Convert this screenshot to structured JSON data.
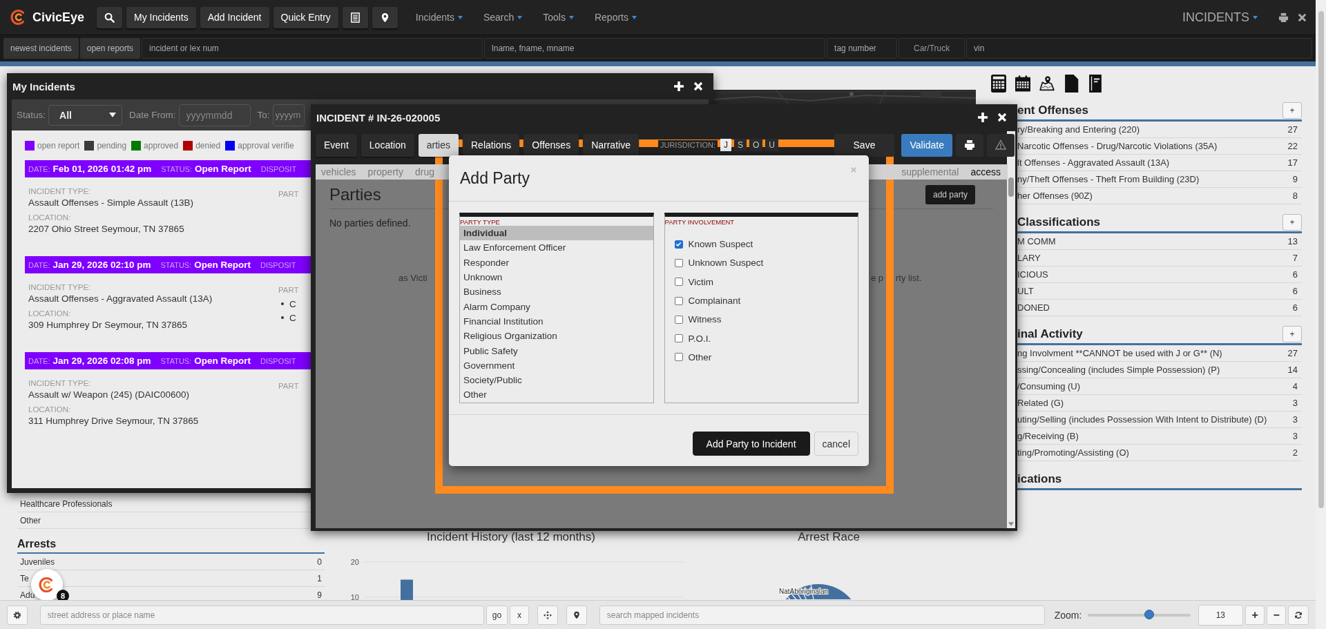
{
  "nav": {
    "brand": "CivicEye",
    "buttons": [
      {
        "kind": "search"
      },
      {
        "kind": "text",
        "label": "My Incidents"
      },
      {
        "kind": "text",
        "label": "Add Incident"
      },
      {
        "kind": "text",
        "label": "Quick Entry"
      },
      {
        "kind": "list"
      },
      {
        "kind": "marker"
      }
    ],
    "menus": [
      "Incidents",
      "Search",
      "Tools",
      "Reports"
    ],
    "module": "INCIDENTS"
  },
  "quick_search": {
    "buttons": [
      "newest incidents",
      "open reports"
    ],
    "fields": [
      {
        "kind": "input",
        "placeholder": "incident or lex num"
      },
      {
        "kind": "input",
        "placeholder": "lname, fname, mname"
      },
      {
        "kind": "input",
        "placeholder": "tag number"
      },
      {
        "kind": "select",
        "value": "Car/Truck"
      },
      {
        "kind": "input",
        "placeholder": "vin"
      }
    ]
  },
  "dashboard": {
    "left": {
      "items": [
        "Healthcare Professionals",
        "Other"
      ],
      "arrests": {
        "title": "Arrests",
        "rows": [
          {
            "label": "Juveniles",
            "count": "0"
          },
          {
            "label": "Te",
            "count": "1"
          },
          {
            "label": "Adu",
            "count": "9"
          }
        ]
      }
    },
    "incident_history": {
      "chart_data": {
        "type": "bar",
        "title": "Incident History (last 12 months)",
        "values": [
          15
        ],
        "ylim": [
          0,
          20
        ],
        "yticks": [
          10,
          20
        ]
      }
    },
    "arrest_race": {
      "title": "Arrest Race",
      "label": "NatAboriginalan"
    },
    "sections": [
      {
        "title": "ent Offenses",
        "add_button": "+",
        "rows": [
          {
            "label": "ry/Breaking and Entering (220)",
            "count": "27"
          },
          {
            "label": "Narcotic Offenses - Drug/Narcotic Violations (35A)",
            "count": "22"
          },
          {
            "label": "lt Offenses - Aggravated Assault (13A)",
            "count": "17"
          },
          {
            "label": "ny/Theft Offenses - Theft From Building (23D)",
            "count": "9"
          },
          {
            "label": "her Offenses (90Z)",
            "count": "8"
          }
        ]
      },
      {
        "title": "Classifications",
        "add_button": "+",
        "rows": [
          {
            "label": "M COMM",
            "count": "13"
          },
          {
            "label": "LARY",
            "count": "7"
          },
          {
            "label": "ICIOUS",
            "count": "6"
          },
          {
            "label": "ULT",
            "count": "6"
          },
          {
            "label": "DONED",
            "count": "6"
          }
        ]
      },
      {
        "title": "inal Activity",
        "add_button": "+",
        "rows": [
          {
            "label": "ng Involvment **CANNOT be used with J or G** (N)",
            "count": "27"
          },
          {
            "label": "ssing/Concealing (includes Simple Possession) (P)",
            "count": "14"
          },
          {
            "label": "/Consuming (U)",
            "count": "4"
          },
          {
            "label": "Related (G)",
            "count": "3"
          },
          {
            "label": "uting/Selling (includes Possession With Intent to Distribute) (D)",
            "count": "3"
          },
          {
            "label": "g/Receiving (B)",
            "count": "3"
          },
          {
            "label": "ting/Promoting/Assisting (O)",
            "count": "2"
          }
        ]
      },
      {
        "title": "ications"
      }
    ]
  },
  "my_incidents": {
    "title": "My Incidents",
    "filters": {
      "status_label": "Status:",
      "status_value": "All",
      "date_from_label": "Date From:",
      "date_from_placeholder": "yyyymmdd",
      "to_label": "To:",
      "to_placeholder": "yyyym"
    },
    "legend": [
      {
        "label": "open report",
        "color": "#7f00ff"
      },
      {
        "label": "pending",
        "color": "#3a3a3a"
      },
      {
        "label": "approved",
        "color": "#007a00"
      },
      {
        "label": "denied",
        "color": "#b00000"
      },
      {
        "label": "approval verifie",
        "color": "#0000f0"
      }
    ],
    "incidents": [
      {
        "color": "#7f00ff",
        "date_label": "DATE:",
        "date": "Feb 01, 2026 01:42 pm",
        "status_label": "STATUS:",
        "status": "Open Report",
        "disposition_label": "DISPOSIT",
        "type_label": "INCIDENT TYPE:",
        "type": "Assault Offenses - Simple Assault (13B)",
        "location_label": "LOCATION:",
        "location": "2207 Ohio Street Seymour, TN 37865",
        "parties_label": "PART"
      },
      {
        "color": "#7f00ff",
        "date_label": "DATE:",
        "date": "Jan 29, 2026 02:10 pm",
        "status_label": "STATUS:",
        "status": "Open Report",
        "disposition_label": "DISPOSIT",
        "type_label": "INCIDENT TYPE:",
        "type": "Assault Offenses - Aggravated Assault (13A)",
        "location_label": "LOCATION:",
        "location": "309 Humphrey Dr Seymour, TN 37865",
        "parties_label": "PART",
        "parties": [
          "C",
          "C"
        ]
      },
      {
        "color": "#7f00ff",
        "date_label": "DATE:",
        "date": "Jan 29, 2026 02:08 pm",
        "status_label": "STATUS:",
        "status": "Open Report",
        "disposition_label": "DISPOSIT",
        "type_label": "INCIDENT TYPE:",
        "type": "Assault w/ Weapon (245) (DAIC00600)",
        "location_label": "LOCATION:",
        "location": "311 Humphrey Drive Seymour, TN 37865",
        "parties_label": "PART"
      }
    ]
  },
  "incident_window": {
    "title": "INCIDENT # IN-26-020005",
    "tabs": [
      {
        "label": "Event",
        "selected": false
      },
      {
        "label": "Location",
        "selected": false
      },
      {
        "label": "arties",
        "selected": true
      },
      {
        "label": "Relations",
        "selected": false
      },
      {
        "label": "Offenses",
        "selected": false
      },
      {
        "label": "Narrative",
        "selected": false
      }
    ],
    "jurisdiction": {
      "label": "JURISDICTION:",
      "options": [
        {
          "label": "J",
          "selected": true
        },
        {
          "label": "S",
          "selected": false
        },
        {
          "label": "O",
          "selected": false
        },
        {
          "label": "U",
          "selected": false
        }
      ]
    },
    "actions": [
      {
        "kind": "save",
        "label": "Save"
      },
      {
        "kind": "primary",
        "label": "Validate"
      },
      {
        "kind": "print"
      },
      {
        "kind": "warning"
      }
    ],
    "subtabs": {
      "left": [
        {
          "label": "vehicles",
          "selected": false
        },
        {
          "label": "property",
          "selected": false
        },
        {
          "label": "drug",
          "selected": false
        }
      ],
      "right": [
        {
          "label": "supplemental",
          "selected": false
        },
        {
          "label": "access",
          "selected": true
        }
      ]
    },
    "section_title": "Parties",
    "add_button": "add party",
    "empty_text": "No parties defined.",
    "hint_fragments": [
      "as Victi",
      "e p",
      "rty list."
    ]
  },
  "dialog": {
    "title": "Add Party",
    "party_type": {
      "label": "PARTY TYPE",
      "items": [
        {
          "label": "Individual",
          "selected": true
        },
        {
          "label": "Law Enforcement Officer",
          "selected": false
        },
        {
          "label": "Responder",
          "selected": false
        },
        {
          "label": "Unknown",
          "selected": false
        },
        {
          "label": "Business",
          "selected": false
        },
        {
          "label": "Alarm Company",
          "selected": false
        },
        {
          "label": "Financial Institution",
          "selected": false
        },
        {
          "label": "Religious Organization",
          "selected": false
        },
        {
          "label": "Public Safety",
          "selected": false
        },
        {
          "label": "Government",
          "selected": false
        },
        {
          "label": "Society/Public",
          "selected": false
        },
        {
          "label": "Other",
          "selected": false
        }
      ]
    },
    "involvement": {
      "label": "PARTY INVOLVEMENT",
      "items": [
        {
          "label": "Known Suspect",
          "checked": true
        },
        {
          "label": "Unknown Suspect",
          "checked": false
        },
        {
          "label": "Victim",
          "checked": false
        },
        {
          "label": "Complainant",
          "checked": false
        },
        {
          "label": "Witness",
          "checked": false
        },
        {
          "label": "P.O.I.",
          "checked": false
        },
        {
          "label": "Other",
          "checked": false
        }
      ]
    },
    "buttons": [
      {
        "kind": "primary",
        "label": "Add Party to Incident"
      },
      {
        "kind": "default",
        "label": "cancel"
      }
    ]
  },
  "bottom_bar": {
    "address": {
      "placeholder": "street address or place name"
    },
    "go": "go",
    "clear": "x",
    "mapped_search": {
      "placeholder": "search mapped incidents"
    },
    "zoom": {
      "label": "Zoom:",
      "level": 0.6,
      "value": "13"
    },
    "zoom_in": "+",
    "zoom_out": "−"
  },
  "chat": {
    "badge": "8"
  }
}
